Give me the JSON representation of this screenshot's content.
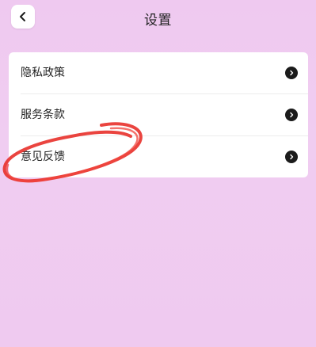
{
  "header": {
    "title": "设置",
    "back_icon": "chevron-left-icon"
  },
  "menu": {
    "items": [
      {
        "label": "隐私政策",
        "icon": "chevron-right-circle-icon"
      },
      {
        "label": "服务条款",
        "icon": "chevron-right-circle-icon"
      },
      {
        "label": "意见反馈",
        "icon": "chevron-right-circle-icon"
      }
    ]
  },
  "annotation": {
    "type": "hand-drawn-circle",
    "color": "#e8302a",
    "target": "意见反馈"
  },
  "colors": {
    "background": "#efc9f0",
    "card": "#ffffff",
    "arrow_circle": "#1b1b1b"
  }
}
